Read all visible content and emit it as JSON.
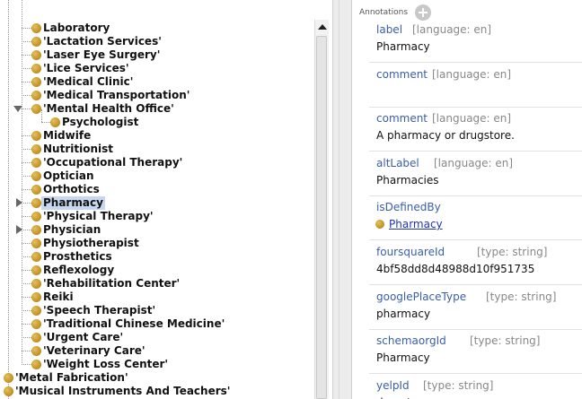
{
  "tree": {
    "items": [
      {
        "label": "Laboratory",
        "quoted": false,
        "depth": 1,
        "toggle": "none",
        "selected": false
      },
      {
        "label": "'Lactation Services'",
        "quoted": true,
        "depth": 1,
        "toggle": "none",
        "selected": false
      },
      {
        "label": "'Laser Eye Surgery'",
        "quoted": true,
        "depth": 1,
        "toggle": "none",
        "selected": false
      },
      {
        "label": "'Lice Services'",
        "quoted": true,
        "depth": 1,
        "toggle": "none",
        "selected": false
      },
      {
        "label": "'Medical Clinic'",
        "quoted": true,
        "depth": 1,
        "toggle": "none",
        "selected": false
      },
      {
        "label": "'Medical Transportation'",
        "quoted": true,
        "depth": 1,
        "toggle": "none",
        "selected": false
      },
      {
        "label": "'Mental Health Office'",
        "quoted": true,
        "depth": 1,
        "toggle": "expanded",
        "selected": false
      },
      {
        "label": "Psychologist",
        "quoted": false,
        "depth": 2,
        "toggle": "none",
        "selected": false
      },
      {
        "label": "Midwife",
        "quoted": false,
        "depth": 1,
        "toggle": "none",
        "selected": false
      },
      {
        "label": "Nutritionist",
        "quoted": false,
        "depth": 1,
        "toggle": "none",
        "selected": false
      },
      {
        "label": "'Occupational Therapy'",
        "quoted": true,
        "depth": 1,
        "toggle": "none",
        "selected": false
      },
      {
        "label": "Optician",
        "quoted": false,
        "depth": 1,
        "toggle": "none",
        "selected": false
      },
      {
        "label": "Orthotics",
        "quoted": false,
        "depth": 1,
        "toggle": "none",
        "selected": false
      },
      {
        "label": "Pharmacy",
        "quoted": false,
        "depth": 1,
        "toggle": "collapsed",
        "selected": true
      },
      {
        "label": "'Physical Therapy'",
        "quoted": true,
        "depth": 1,
        "toggle": "none",
        "selected": false
      },
      {
        "label": "Physician",
        "quoted": false,
        "depth": 1,
        "toggle": "collapsed",
        "selected": false
      },
      {
        "label": "Physiotherapist",
        "quoted": false,
        "depth": 1,
        "toggle": "none",
        "selected": false
      },
      {
        "label": "Prosthetics",
        "quoted": false,
        "depth": 1,
        "toggle": "none",
        "selected": false
      },
      {
        "label": "Reflexology",
        "quoted": false,
        "depth": 1,
        "toggle": "none",
        "selected": false
      },
      {
        "label": "'Rehabilitation Center'",
        "quoted": true,
        "depth": 1,
        "toggle": "none",
        "selected": false
      },
      {
        "label": "Reiki",
        "quoted": false,
        "depth": 1,
        "toggle": "none",
        "selected": false
      },
      {
        "label": "'Speech Therapist'",
        "quoted": true,
        "depth": 1,
        "toggle": "none",
        "selected": false
      },
      {
        "label": "'Traditional Chinese Medicine'",
        "quoted": true,
        "depth": 1,
        "toggle": "none",
        "selected": false
      },
      {
        "label": "'Urgent Care'",
        "quoted": true,
        "depth": 1,
        "toggle": "none",
        "selected": false
      },
      {
        "label": "'Veterinary Care'",
        "quoted": true,
        "depth": 1,
        "toggle": "none",
        "selected": false
      },
      {
        "label": "'Weight Loss Center'",
        "quoted": true,
        "depth": 1,
        "toggle": "none",
        "selected": false
      },
      {
        "label": "'Metal Fabrication'",
        "quoted": true,
        "depth": 0,
        "toggle": "none",
        "selected": false
      },
      {
        "label": "'Musical Instruments And Teachers'",
        "quoted": true,
        "depth": 0,
        "toggle": "none",
        "selected": false
      }
    ]
  },
  "annotations": {
    "header": "Annotations",
    "items": [
      {
        "property": "label",
        "meta": "[language: en]",
        "value": "Pharmacy",
        "is_link": false
      },
      {
        "property": "comment",
        "meta": "[language: en]",
        "value": "",
        "is_link": false
      },
      {
        "property": "comment",
        "meta": "[language: en]",
        "value": "A pharmacy or drugstore.",
        "is_link": false
      },
      {
        "property": "altLabel",
        "meta": "[language: en]",
        "value": "Pharmacies",
        "is_link": false
      },
      {
        "property": "isDefinedBy",
        "meta": "",
        "value": "Pharmacy",
        "is_link": true
      },
      {
        "property": "foursquareId",
        "meta": "[type: string]",
        "value": "4bf58dd8d48988d10f951735",
        "is_link": false
      },
      {
        "property": "googlePlaceType",
        "meta": "[type: string]",
        "value": "pharmacy",
        "is_link": false
      },
      {
        "property": "schemaorgId",
        "meta": "[type: string]",
        "value": "Pharmacy",
        "is_link": false
      },
      {
        "property": "yelpId",
        "meta": "[type: string]",
        "value": "drugstores",
        "is_link": false
      }
    ]
  },
  "colors": {
    "selection": "#c7d7ee",
    "property": "#3a5ea6",
    "link": "#1d34b8",
    "individual_dot": "#c9992a"
  }
}
